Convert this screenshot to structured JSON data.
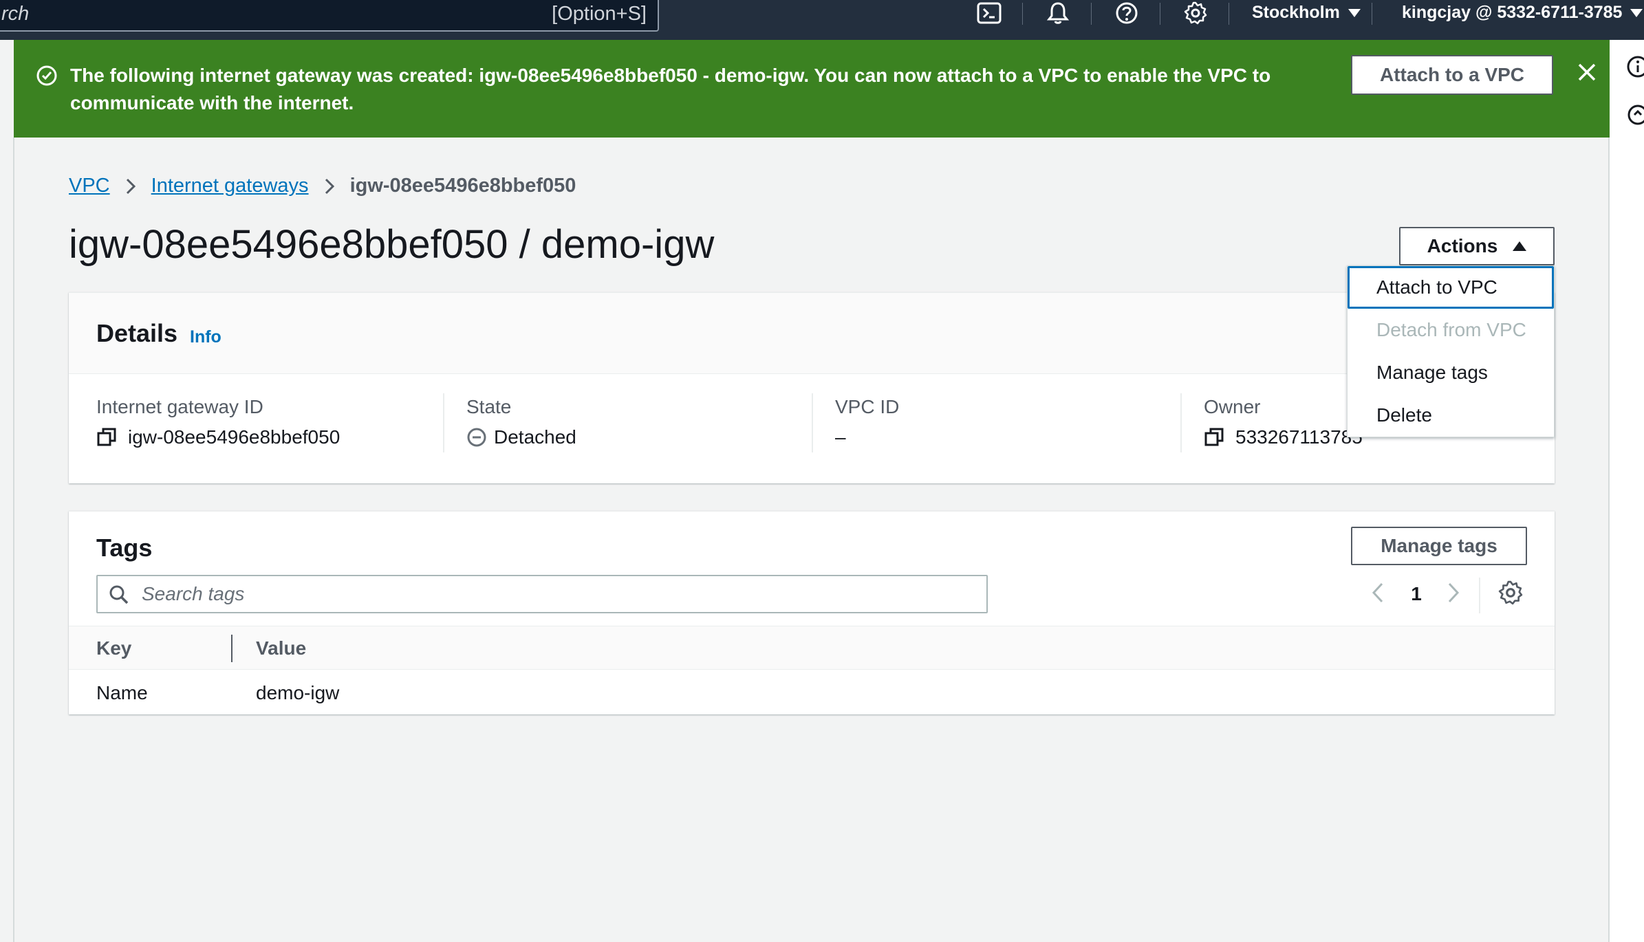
{
  "topnav": {
    "search_placeholder": "rch",
    "search_shortcut": "[Option+S]",
    "icons": [
      "cloudshell-icon",
      "bell-icon",
      "help-icon",
      "gear-icon"
    ],
    "region": "Stockholm",
    "account": "kingcjay @ 5332-6711-3785"
  },
  "flash": {
    "message": "The following internet gateway was created: igw-08ee5496e8bbef050 - demo-igw. You can now attach to a VPC to enable the VPC to communicate with the internet.",
    "button": "Attach to a VPC",
    "color": "#3b8221"
  },
  "breadcrumb": {
    "items": [
      "VPC",
      "Internet gateways"
    ],
    "current": "igw-08ee5496e8bbef050"
  },
  "page": {
    "title": "igw-08ee5496e8bbef050 / demo-igw",
    "actions_label": "Actions"
  },
  "actions_menu": {
    "items": [
      {
        "label": "Attach to VPC"
      },
      {
        "label": "Detach from VPC"
      },
      {
        "label": "Manage tags"
      },
      {
        "label": "Delete"
      }
    ]
  },
  "details": {
    "title": "Details",
    "info": "Info",
    "fields": [
      {
        "label": "Internet gateway ID",
        "value": "igw-08ee5496e8bbef050"
      },
      {
        "label": "State",
        "value": "Detached"
      },
      {
        "label": "VPC ID",
        "value": "–"
      },
      {
        "label": "Owner",
        "value": "533267113785"
      }
    ]
  },
  "tags": {
    "title": "Tags",
    "manage_button": "Manage tags",
    "search_placeholder": "Search tags",
    "page": "1",
    "columns": [
      "Key",
      "Value"
    ],
    "rows": [
      {
        "key": "Name",
        "value": "demo-igw"
      }
    ]
  },
  "colors": {
    "nav_bg": "#232f3e",
    "link": "#0073bb",
    "success": "#3b8221"
  }
}
